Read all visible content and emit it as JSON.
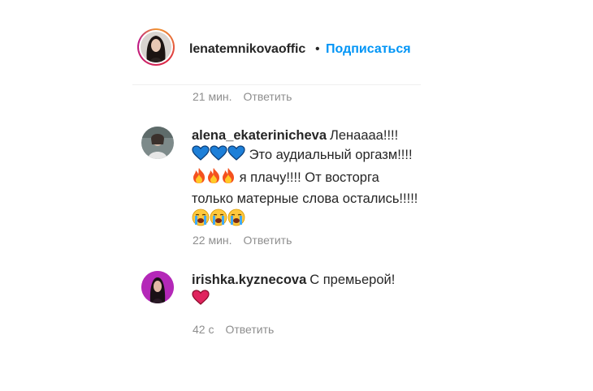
{
  "header": {
    "username": "lenatemnikovaoffic",
    "separator": "•",
    "follow_label": "Подписаться"
  },
  "post_meta": {
    "time": "21 мин.",
    "reply_label": "Ответить"
  },
  "comments": [
    {
      "username": "alena_ekaterinicheva",
      "text_line1": "Ленаааа!!!!",
      "text_part2": "Это аудиальный оргазм!!!!",
      "text_part3": "я плачу!!!! От восторга только матерные слова остались!!!!!",
      "time": "22 мин.",
      "reply_label": "Ответить"
    },
    {
      "username": "irishka.kyznecova",
      "text": "С премьерой!",
      "time": "42 с",
      "reply_label": "Ответить"
    }
  ],
  "colors": {
    "accent": "#0095f6",
    "muted": "#8e8e8e",
    "text": "#262626"
  }
}
